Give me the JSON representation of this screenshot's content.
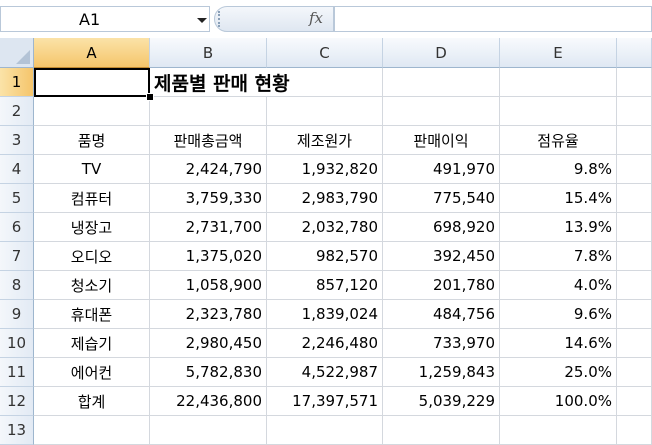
{
  "formula_bar": {
    "name_box": "A1",
    "fx_label": "fx",
    "formula": ""
  },
  "columns": [
    "A",
    "B",
    "C",
    "D",
    "E"
  ],
  "rows": [
    "1",
    "2",
    "3",
    "4",
    "5",
    "6",
    "7",
    "8",
    "9",
    "10",
    "11",
    "12",
    "13"
  ],
  "sheet": {
    "title": "제품별 판매 현황",
    "headers": [
      "품명",
      "판매총금액",
      "제조원가",
      "판매이익",
      "점유율"
    ],
    "data": [
      [
        "TV",
        "2,424,790",
        "1,932,820",
        "491,970",
        "9.8%"
      ],
      [
        "컴퓨터",
        "3,759,330",
        "2,983,790",
        "775,540",
        "15.4%"
      ],
      [
        "냉장고",
        "2,731,700",
        "2,032,780",
        "698,920",
        "13.9%"
      ],
      [
        "오디오",
        "1,375,020",
        "982,570",
        "392,450",
        "7.8%"
      ],
      [
        "청소기",
        "1,058,900",
        "857,120",
        "201,780",
        "4.0%"
      ],
      [
        "휴대폰",
        "2,323,780",
        "1,839,024",
        "484,756",
        "9.6%"
      ],
      [
        "제습기",
        "2,980,450",
        "2,246,480",
        "733,970",
        "14.6%"
      ],
      [
        "에어컨",
        "5,782,830",
        "4,522,987",
        "1,259,843",
        "25.0%"
      ],
      [
        "합계",
        "22,436,800",
        "17,397,571",
        "5,039,229",
        "100.0%"
      ]
    ]
  }
}
